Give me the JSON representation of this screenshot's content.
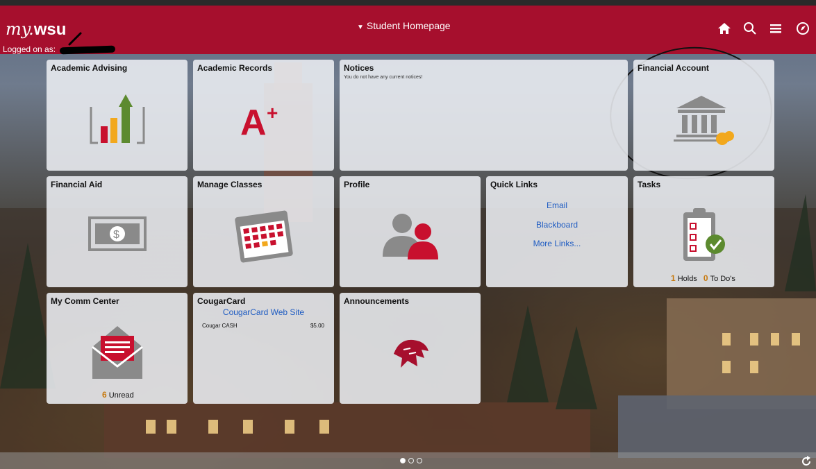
{
  "header": {
    "logo_my": "my.",
    "logo_wsu": "wsu",
    "logged_on": "Logged on as:",
    "title": "Student Homepage",
    "icons": [
      "home-icon",
      "search-icon",
      "menu-icon",
      "navbar-icon"
    ]
  },
  "tiles": {
    "academic_advising": "Academic Advising",
    "academic_records": "Academic Records",
    "notices": {
      "title": "Notices",
      "text": "You do not have any current notices!"
    },
    "financial_account": "Financial Account",
    "financial_aid": "Financial Aid",
    "manage_classes": "Manage Classes",
    "profile": "Profile",
    "quick_links": {
      "title": "Quick Links",
      "links": [
        "Email",
        "Blackboard",
        "More Links..."
      ]
    },
    "tasks": {
      "title": "Tasks",
      "holds_count": "1",
      "holds_label": "Holds",
      "todos_count": "0",
      "todos_label": "To Do's"
    },
    "comm_center": {
      "title": "My Comm Center",
      "unread_count": "6",
      "unread_label": "Unread"
    },
    "cougarcard": {
      "title": "CougarCard",
      "link": "CougarCard Web Site",
      "cash_label": "Cougar CASH",
      "cash_value": "$5.00"
    },
    "announcements": "Announcements"
  },
  "pager": {
    "pages": 3,
    "current": 1
  },
  "colors": {
    "brand": "#a60f2d",
    "link": "#1f5cc2",
    "count": "#c77a10"
  }
}
